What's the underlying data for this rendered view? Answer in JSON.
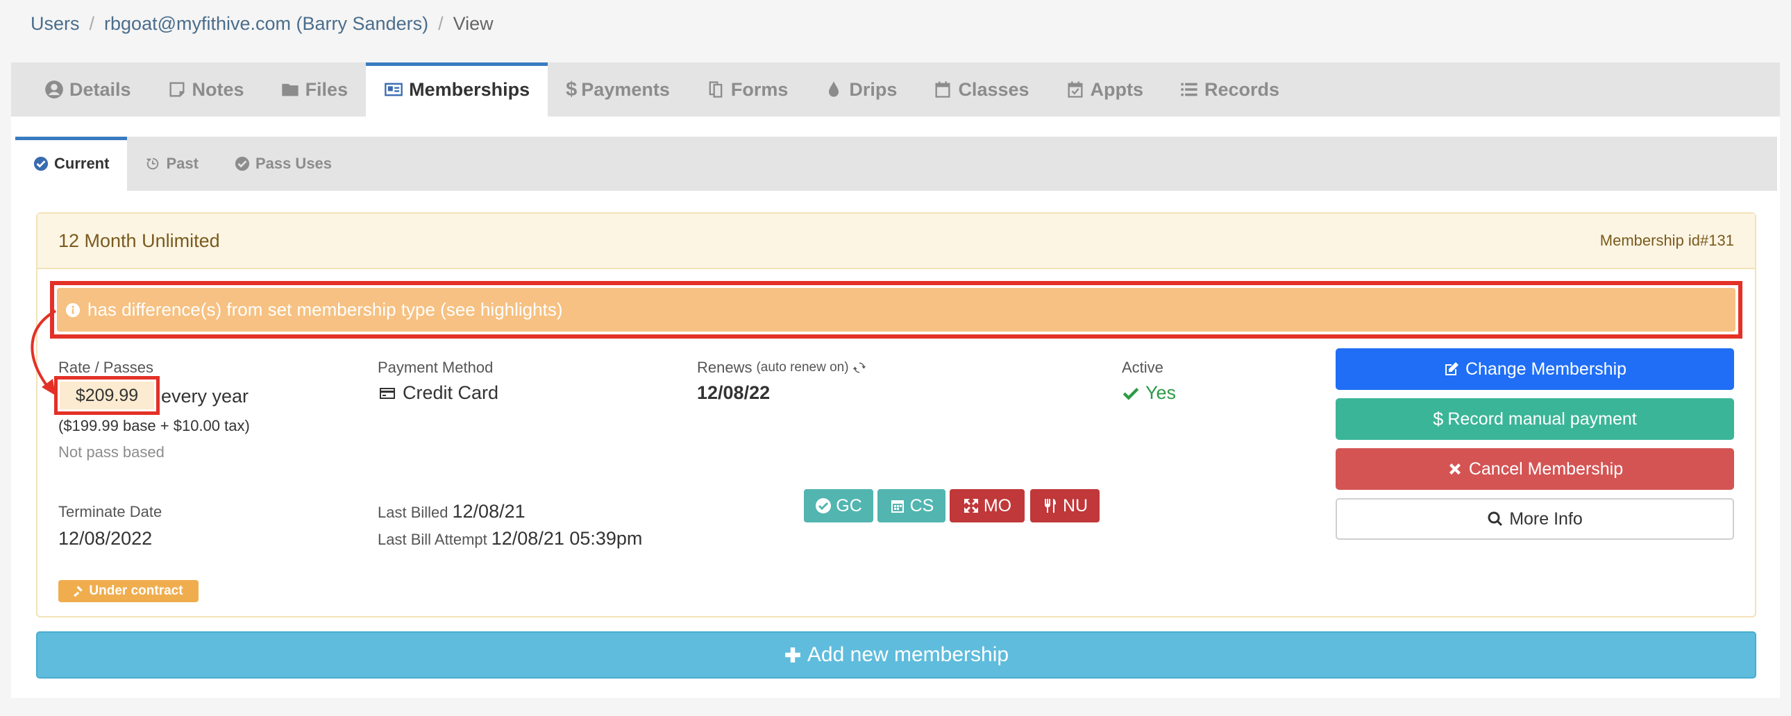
{
  "breadcrumb": {
    "users": "Users",
    "user": "rbgoat@myfithive.com (Barry Sanders)",
    "current": "View"
  },
  "tabs": {
    "details": "Details",
    "notes": "Notes",
    "files": "Files",
    "memberships": "Memberships",
    "payments": "Payments",
    "forms": "Forms",
    "drips": "Drips",
    "classes": "Classes",
    "appts": "Appts",
    "records": "Records"
  },
  "subtabs": {
    "current": "Current",
    "past": "Past",
    "pass_uses": "Pass Uses"
  },
  "membership": {
    "title": "12 Month Unlimited",
    "id_label": "Membership id#131",
    "warning": "has difference(s) from set membership type (see highlights)",
    "rate_label": "Rate / Passes",
    "price": "$209.99",
    "period": "every year",
    "breakdown": "($199.99 base + $10.00 tax)",
    "pass_note": "Not pass based",
    "payment_label": "Payment Method",
    "payment_value": "Credit Card",
    "renews_label": "Renews",
    "renews_note": "(auto renew on)",
    "renews_date": "12/08/22",
    "active_label": "Active",
    "active_value": "Yes",
    "terminate_label": "Terminate Date",
    "terminate_value": "12/08/2022",
    "last_billed_label": "Last Billed",
    "last_billed_value": "12/08/21",
    "last_attempt_label": "Last Bill Attempt",
    "last_attempt_value": "12/08/21 05:39pm",
    "contract": "Under contract"
  },
  "badges": {
    "gc": "GC",
    "cs": "CS",
    "mo": "MO",
    "nu": "NU"
  },
  "buttons": {
    "change": "Change Membership",
    "record": "Record manual payment",
    "cancel": "Cancel Membership",
    "more": "More Info",
    "add": "Add new membership"
  },
  "colors": {
    "tab_accent": "#3a7bbf",
    "warning_bg": "#f6c182",
    "highlight_red": "#e33127",
    "btn_primary": "#1f6ef5",
    "btn_success": "#3bb597",
    "btn_danger": "#d45454",
    "badge_teal": "#52b5b0",
    "badge_red": "#c0383a",
    "add_bg": "#5fbcdc"
  }
}
